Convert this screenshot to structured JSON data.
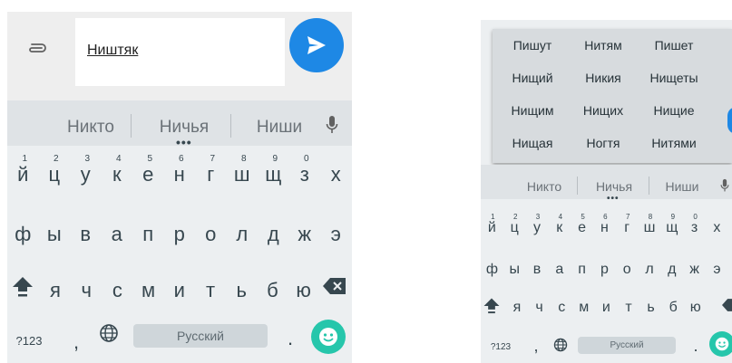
{
  "left": {
    "message_text": "Ништяк",
    "suggestions": [
      "Никто",
      "Ничья",
      "Ниши"
    ],
    "number_hints": [
      "1",
      "2",
      "3",
      "4",
      "5",
      "6",
      "7",
      "8",
      "9",
      "0"
    ],
    "row1": [
      "й",
      "ц",
      "у",
      "к",
      "е",
      "н",
      "г",
      "ш",
      "щ",
      "з",
      "х"
    ],
    "row2": [
      "ф",
      "ы",
      "в",
      "а",
      "п",
      "р",
      "о",
      "л",
      "д",
      "ж",
      "э"
    ],
    "row3": [
      "я",
      "ч",
      "с",
      "м",
      "и",
      "т",
      "ь",
      "б",
      "ю"
    ],
    "bottom": {
      "symbols_label": "?123",
      "comma_label": ",",
      "space_label": "Русский",
      "period_label": "."
    }
  },
  "right": {
    "popup_words": [
      "Пишут",
      "Нитям",
      "Пишет",
      "Нищий",
      "Никия",
      "Нищеты",
      "Нищим",
      "Нищих",
      "Нищие",
      "Нищая",
      "Ногтя",
      "Нитями"
    ],
    "suggestions": [
      "Никто",
      "Ничья",
      "Ниши"
    ],
    "number_hints": [
      "1",
      "2",
      "3",
      "4",
      "5",
      "6",
      "7",
      "8",
      "9",
      "0"
    ],
    "row1": [
      "й",
      "ц",
      "у",
      "к",
      "е",
      "н",
      "г",
      "ш",
      "щ",
      "з",
      "х"
    ],
    "row2": [
      "ф",
      "ы",
      "в",
      "а",
      "п",
      "р",
      "о",
      "л",
      "д",
      "ж",
      "э"
    ],
    "row3": [
      "я",
      "ч",
      "с",
      "м",
      "и",
      "т",
      "ь",
      "б",
      "ю"
    ],
    "bottom": {
      "symbols_label": "?123",
      "comma_label": ",",
      "space_label": "Русский",
      "period_label": "."
    }
  },
  "colors": {
    "accent_blue": "#1e88e5",
    "emoji_teal": "#26c6ab",
    "keyboard_bg": "#eceff1"
  },
  "icons": [
    "paperclip-icon",
    "send-icon",
    "mic-icon",
    "shift-icon",
    "backspace-icon",
    "globe-icon",
    "emoji-icon"
  ]
}
